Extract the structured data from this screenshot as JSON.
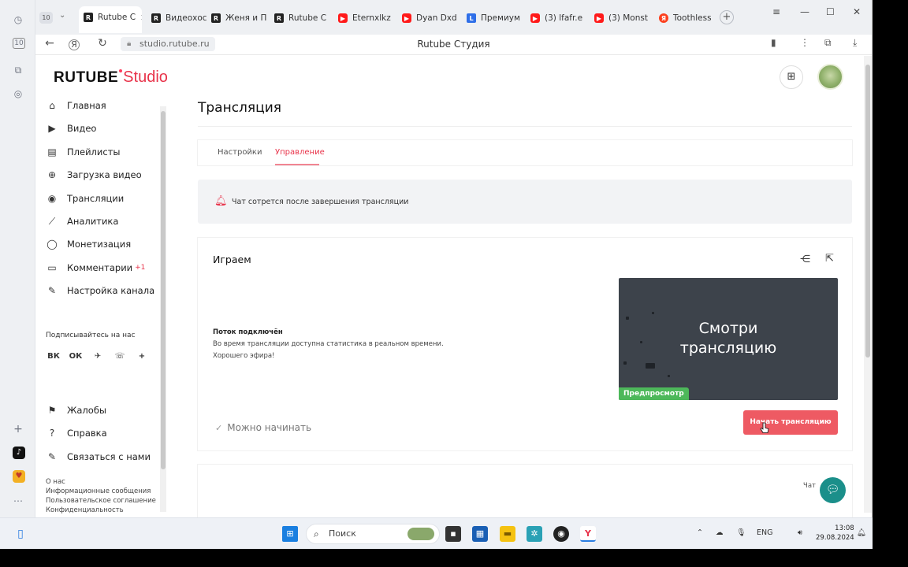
{
  "browser": {
    "tab_counter": "10",
    "tabs": [
      {
        "label": "Rutube С",
        "fav": "R",
        "favclass": "rt"
      },
      {
        "label": "Видеохос",
        "fav": "R",
        "favclass": "rt"
      },
      {
        "label": "Женя и П",
        "fav": "R",
        "favclass": "rt"
      },
      {
        "label": "Rutube С",
        "fav": "R",
        "favclass": "rt"
      },
      {
        "label": "Eternxlkz",
        "fav": "▶",
        "favclass": "yt"
      },
      {
        "label": "Dyan Dxd",
        "fav": "▶",
        "favclass": "yt"
      },
      {
        "label": "Премиум",
        "fav": "L",
        "favclass": "l"
      },
      {
        "label": "(3) lfafr.e",
        "fav": "▶",
        "favclass": "yt"
      },
      {
        "label": "(3) Monst",
        "fav": "▶",
        "favclass": "yt"
      },
      {
        "label": "Toothless",
        "fav": "Я",
        "favclass": "ya"
      }
    ],
    "url": "studio.rutube.ru",
    "page_title": "Rutube Студия"
  },
  "logo": {
    "brand": "RUTUBE",
    "product": "Studio"
  },
  "sidebar": {
    "items": [
      {
        "label": "Главная",
        "icon": "home-icon",
        "glyph": "⌂"
      },
      {
        "label": "Видео",
        "icon": "video-icon",
        "glyph": "▶"
      },
      {
        "label": "Плейлисты",
        "icon": "playlist-icon",
        "glyph": "▤"
      },
      {
        "label": "Загрузка видео",
        "icon": "upload-icon",
        "glyph": "⊕"
      },
      {
        "label": "Трансляции",
        "icon": "broadcast-icon",
        "glyph": "◉"
      },
      {
        "label": "Аналитика",
        "icon": "analytics-icon",
        "glyph": "⟋"
      },
      {
        "label": "Монетизация",
        "icon": "monetization-icon",
        "glyph": "◯"
      },
      {
        "label": "Комментарии",
        "icon": "comments-icon",
        "glyph": "▭",
        "badge": "+1"
      },
      {
        "label": "Настройка канала",
        "icon": "wand-icon",
        "glyph": "✎"
      }
    ],
    "subscribe_label": "Подписывайтесь на нас",
    "socials": [
      "ВК",
      "ОК",
      "✈",
      "☏",
      "+"
    ],
    "bottom_items": [
      {
        "label": "Жалобы",
        "icon": "flag-icon",
        "glyph": "⚑"
      },
      {
        "label": "Справка",
        "icon": "help-icon",
        "glyph": "?"
      },
      {
        "label": "Связаться с нами",
        "icon": "contact-icon",
        "glyph": "✎"
      }
    ],
    "footer_links": [
      "О нас",
      "Информационные сообщения",
      "Пользовательское соглашение",
      "Конфиденциальность"
    ]
  },
  "main": {
    "title": "Трансляция",
    "tabs": [
      "Настройки",
      "Управление"
    ],
    "active_tab": "Управление",
    "notice": "Чат сотрется после завершения трансляции",
    "stream": {
      "title": "Играем",
      "status_title": "Поток подключён",
      "status_line1": "Во время трансляции доступна статистика в реальном времени.",
      "status_line2": "Хорошего эфира!",
      "preview_text_1": "Смотри",
      "preview_text_2": "трансляцию",
      "preview_badge": "Предпросмотр",
      "ready_label": "Можно начинать",
      "start_button": "Начать трансляцию"
    },
    "chat_label": "Чат"
  },
  "taskbar": {
    "search_placeholder": "Поиск",
    "lang": "ENG",
    "time": "13:08",
    "date": "29.08.2024"
  },
  "colors": {
    "accent": "#e8334a",
    "button": "#ee5a63",
    "badge_green": "#4db85a",
    "support": "#1b8f8a"
  }
}
